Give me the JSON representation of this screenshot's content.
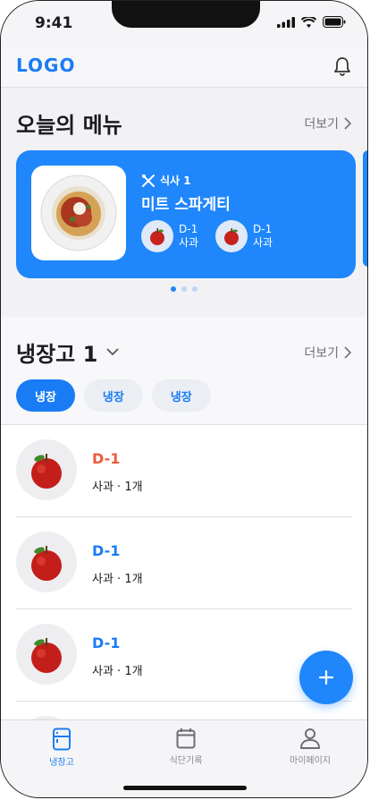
{
  "status_bar": {
    "time": "9:41"
  },
  "header": {
    "logo": "LOGO"
  },
  "today_menu": {
    "title": "오늘의 메뉴",
    "more": "더보기",
    "card": {
      "meal_label": "식사 1",
      "meal_name": "미트 스파게티",
      "ingredients": [
        {
          "dday": "D-1",
          "name": "사과"
        },
        {
          "dday": "D-1",
          "name": "사과"
        }
      ]
    },
    "pager": {
      "count": 3,
      "active": 1
    }
  },
  "fridge": {
    "title": "냉장고 1",
    "more": "더보기",
    "chips": [
      "냉장",
      "냉장",
      "냉장"
    ],
    "items": [
      {
        "dday": "D-1",
        "dday_color": "#ef5a3c",
        "name": "사과",
        "qty": "1개"
      },
      {
        "dday": "D-1",
        "dday_color": "#1a7cf5",
        "name": "사과",
        "qty": "1개"
      },
      {
        "dday": "D-1",
        "dday_color": "#1a7cf5",
        "name": "사과",
        "qty": "1개"
      }
    ]
  },
  "tabs": [
    {
      "label": "냉장고",
      "icon": "fridge-icon",
      "active": true
    },
    {
      "label": "식단기록",
      "icon": "calendar-icon",
      "active": false
    },
    {
      "label": "마이페이지",
      "icon": "person-icon",
      "active": false
    }
  ],
  "colors": {
    "accent": "#1f86fb",
    "urgent": "#ef5a3c"
  }
}
